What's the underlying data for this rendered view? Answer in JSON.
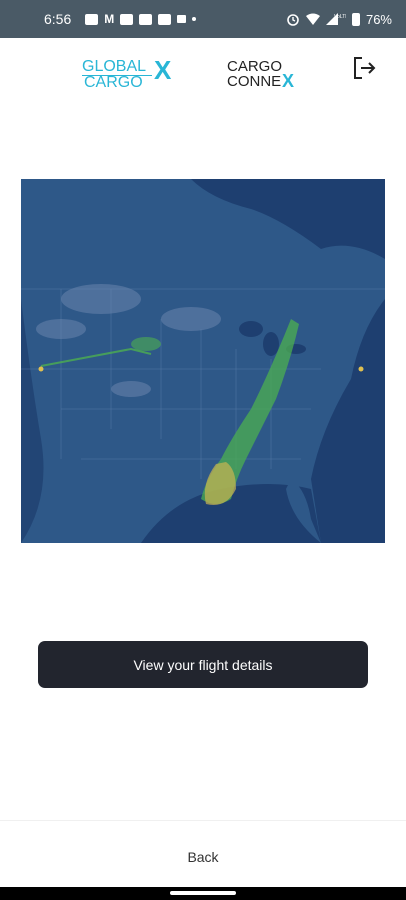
{
  "status_bar": {
    "time": "6:56",
    "battery": "76%",
    "left_icons": [
      "message-icon",
      "m-app-icon",
      "youtube-icon",
      "youtube-icon",
      "teams-icon",
      "p-icon",
      "dot-icon"
    ],
    "right_icons": [
      "alarm-icon",
      "wifi-icon",
      "signal-icon",
      "battery-icon"
    ]
  },
  "header": {
    "logo_global_line1": "GLOBAL",
    "logo_global_line2": "CARGO",
    "logo_global_x": "X",
    "logo_cargo_line1": "CARGO",
    "logo_cargo_line2": "CONNE",
    "logo_cargo_x": "X",
    "logout_icon": "logout-icon"
  },
  "map": {
    "description_icon": "weather-radar-map"
  },
  "main": {
    "details_button_label": "View your flight details"
  },
  "footer": {
    "back_label": "Back"
  },
  "colors": {
    "status_bar": "#4a5a66",
    "button_bg": "#22252e",
    "logo_teal": "#29b6d6",
    "map_land": "#2d5687",
    "map_water": "#1d3d6e",
    "radar_green": "#4caf50"
  }
}
